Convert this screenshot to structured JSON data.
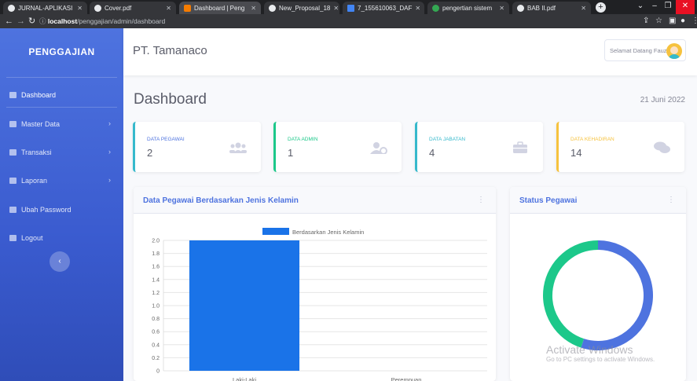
{
  "browser": {
    "tabs": [
      {
        "label": "JURNAL-APLIKASI",
        "fav": "chrome-icon"
      },
      {
        "label": "Cover.pdf",
        "fav": "chrome-icon"
      },
      {
        "label": "Dashboard | Peng",
        "fav": "app-icon"
      },
      {
        "label": "New_Proposal_18",
        "fav": "chrome-icon"
      },
      {
        "label": "7_155610063_DAF",
        "fav": "pdf-icon"
      },
      {
        "label": "pengertian sistem",
        "fav": "google-icon"
      },
      {
        "label": "BAB II.pdf",
        "fav": "chrome-icon"
      }
    ],
    "url_host": "localhost",
    "url_path": "/penggajian/admin/dashboard"
  },
  "sidebar": {
    "brand": "PENGGAJIAN",
    "items": [
      {
        "label": "Dashboard",
        "icon": "dashboard-icon",
        "has_arrow": false
      },
      {
        "label": "Master Data",
        "icon": "folder-icon",
        "has_arrow": true
      },
      {
        "label": "Transaksi",
        "icon": "table-icon",
        "has_arrow": true
      },
      {
        "label": "Laporan",
        "icon": "file-icon",
        "has_arrow": true
      },
      {
        "label": "Ubah Password",
        "icon": "lock-icon",
        "has_arrow": false
      },
      {
        "label": "Logout",
        "icon": "sign-out-icon",
        "has_arrow": false
      }
    ]
  },
  "topbar": {
    "company": "PT. Tamanaco",
    "greeting": "Selamat Datang Fauzi"
  },
  "page": {
    "title": "Dashboard",
    "date": "21 Juni 2022"
  },
  "cards": [
    {
      "label": "DATA PEGAWAI",
      "value": "2",
      "color": "#36b9cc",
      "label_color": "#4e73df",
      "icon": "users-icon"
    },
    {
      "label": "DATA ADMIN",
      "value": "1",
      "color": "#1cc88a",
      "label_color": "#1cc88a",
      "icon": "user-cog-icon"
    },
    {
      "label": "DATA JABATAN",
      "value": "4",
      "color": "#36b9cc",
      "label_color": "#36b9cc",
      "icon": "briefcase-icon"
    },
    {
      "label": "DATA KEHADIRAN",
      "value": "14",
      "color": "#f6c23e",
      "label_color": "#f6c23e",
      "icon": "comments-icon"
    }
  ],
  "panels": {
    "bar_title": "Data Pegawai Berdasarkan Jenis Kelamin",
    "donut_title": "Status Pegawai"
  },
  "chart_data": [
    {
      "type": "bar",
      "categories": [
        "Laki-Laki",
        "Perempuan"
      ],
      "series": [
        {
          "name": "Berdasarkan Jenis Kelamin",
          "values": [
            2,
            0
          ],
          "color": "#1a73e8"
        }
      ],
      "yticks": [
        "2.0",
        "1.8",
        "1.6",
        "1.4",
        "1.2",
        "1.0",
        "0.8",
        "0.6",
        "0.4",
        "0.2",
        "0"
      ],
      "ylim": [
        0,
        2
      ],
      "legend": "top",
      "grid": true
    },
    {
      "type": "pie",
      "values": [
        55,
        45
      ],
      "colors": [
        "#4e73df",
        "#1cc88a"
      ]
    }
  ],
  "watermark": {
    "line1": "Activate Windows",
    "line2": "Go to PC settings to activate Windows."
  }
}
